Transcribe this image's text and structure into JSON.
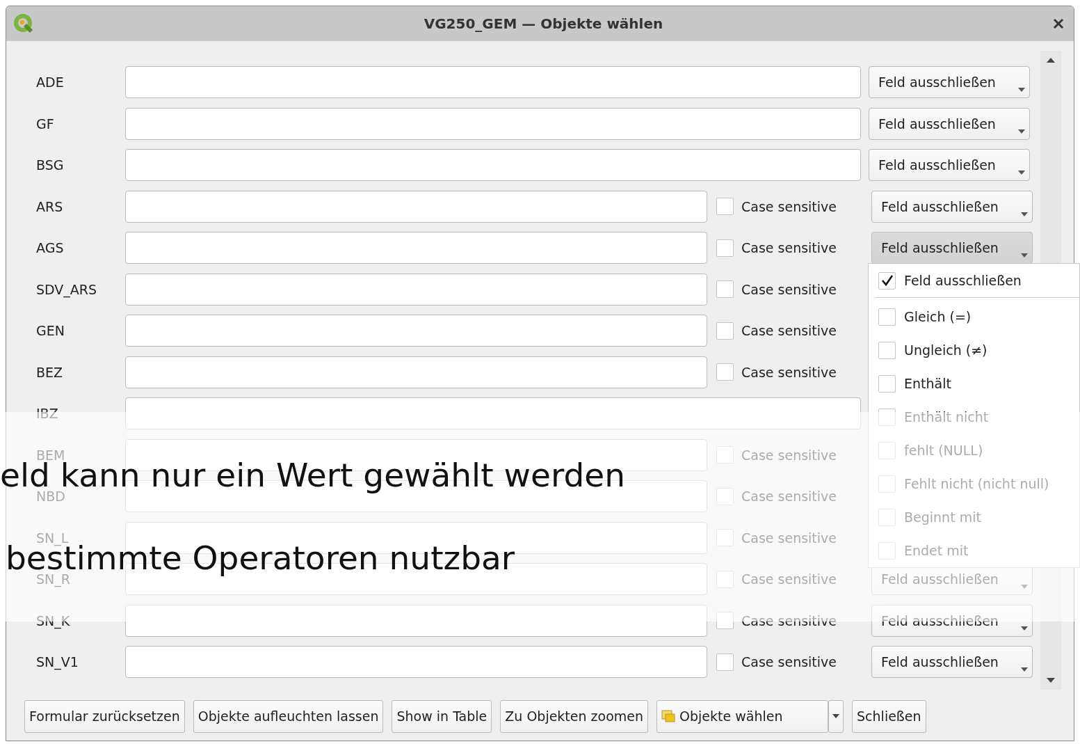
{
  "window": {
    "title": "VG250_GEM — Objekte wählen"
  },
  "fields": [
    {
      "label": "ADE",
      "kind": "plain",
      "button": {
        "label": "Feld ausschließen",
        "pressed": false
      }
    },
    {
      "label": "GF",
      "kind": "plain",
      "button": {
        "label": "Feld ausschließen",
        "pressed": false
      }
    },
    {
      "label": "BSG",
      "kind": "plain",
      "button": {
        "label": "Feld ausschließen",
        "pressed": false
      }
    },
    {
      "label": "ARS",
      "kind": "text",
      "case_sensitive": {
        "label": "Case sensitive",
        "checked": false
      },
      "button": {
        "label": "Feld ausschließen",
        "pressed": false
      }
    },
    {
      "label": "AGS",
      "kind": "text",
      "case_sensitive": {
        "label": "Case sensitive",
        "checked": false
      },
      "button": {
        "label": "Feld ausschließen",
        "pressed": true
      }
    },
    {
      "label": "SDV_ARS",
      "kind": "text",
      "case_sensitive": {
        "label": "Case sensitive",
        "checked": false
      }
    },
    {
      "label": "GEN",
      "kind": "text",
      "case_sensitive": {
        "label": "Case sensitive",
        "checked": false
      }
    },
    {
      "label": "BEZ",
      "kind": "text",
      "case_sensitive": {
        "label": "Case sensitive",
        "checked": false
      }
    },
    {
      "label": "IBZ",
      "kind": "plain"
    },
    {
      "label": "BEM",
      "kind": "text",
      "case_sensitive": {
        "label": "Case sensitive",
        "checked": false
      }
    },
    {
      "label": "NBD",
      "kind": "text",
      "case_sensitive": {
        "label": "Case sensitive",
        "checked": false
      }
    },
    {
      "label": "SN_L",
      "kind": "text",
      "case_sensitive": {
        "label": "Case sensitive",
        "checked": false
      }
    },
    {
      "label": "SN_R",
      "kind": "text",
      "case_sensitive": {
        "label": "Case sensitive",
        "checked": false
      },
      "button": {
        "label": "Feld ausschließen",
        "pressed": false
      }
    },
    {
      "label": "SN_K",
      "kind": "text",
      "case_sensitive": {
        "label": "Case sensitive",
        "checked": false
      },
      "button": {
        "label": "Feld ausschließen",
        "pressed": false
      }
    },
    {
      "label": "SN_V1",
      "kind": "text",
      "case_sensitive": {
        "label": "Case sensitive",
        "checked": false
      },
      "button": {
        "label": "Feld ausschließen",
        "pressed": false
      }
    }
  ],
  "operator_menu": {
    "items": [
      {
        "label": "Feld ausschließen",
        "checked": true,
        "separator_after": true
      },
      {
        "label": "Gleich (=)",
        "checked": false
      },
      {
        "label": "Ungleich (≠)",
        "checked": false
      },
      {
        "label": "Enthält",
        "checked": false
      },
      {
        "label": "Enthält nicht",
        "checked": false
      },
      {
        "label": "fehlt (NULL)",
        "checked": false
      },
      {
        "label": "Fehlt nicht (nicht null)",
        "checked": false
      },
      {
        "label": "Beginnt mit",
        "checked": false
      },
      {
        "label": "Endet mit",
        "checked": false
      }
    ]
  },
  "buttons": [
    {
      "label": "Formular zurücksetzen",
      "kind": "plain"
    },
    {
      "label": "Objekte aufleuchten lassen",
      "kind": "plain"
    },
    {
      "label": "Show in Table",
      "kind": "plain"
    },
    {
      "label": "Zu Objekten zoomen",
      "kind": "plain"
    },
    {
      "label": "Objekte wählen",
      "kind": "split"
    },
    {
      "label": "Schließen",
      "kind": "plain"
    }
  ],
  "overlay": {
    "lines": [
      "eld kann nur ein Wert gewählt werden",
      "bestimmte Operatoren nutzbar"
    ]
  }
}
